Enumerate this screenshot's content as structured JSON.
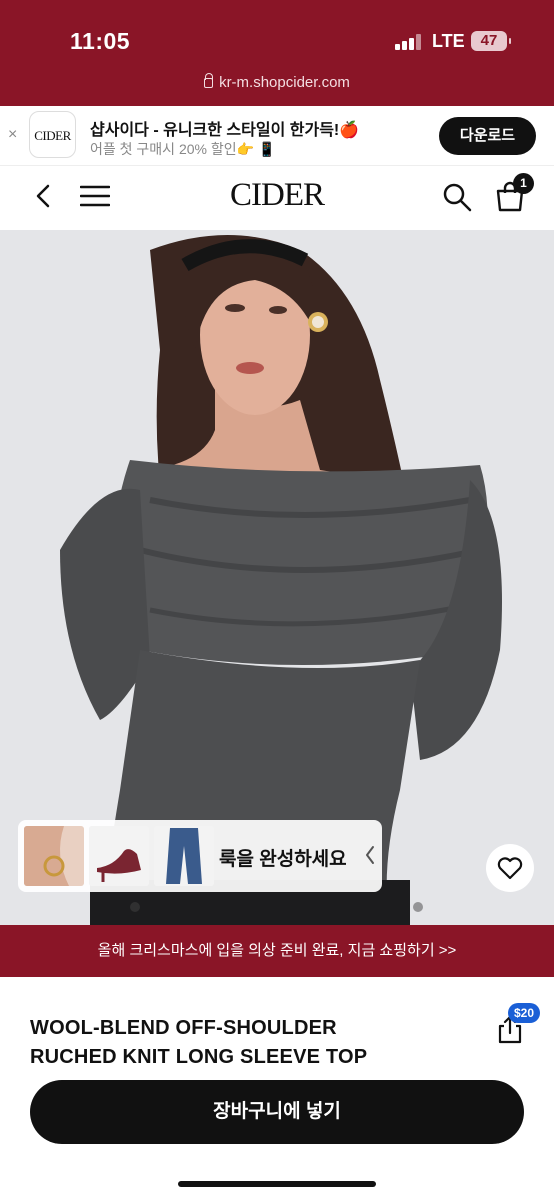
{
  "status_bar": {
    "time": "11:05",
    "network": "LTE",
    "battery": "47",
    "url": "kr-m.shopcider.com"
  },
  "app_banner": {
    "close_label": "×",
    "app_icon_label": "CIDER",
    "title": "샵사이다 - 유니크한 스타일이 한가득!🍎",
    "subtitle": "어플 첫 구매시 20% 할인👉 📱",
    "download_label": "다운로드"
  },
  "nav": {
    "logo": "CIDER",
    "cart_count": "1"
  },
  "look_card": {
    "label": "룩을 완성하세요",
    "thumbnails": [
      "earrings",
      "heels",
      "jeans"
    ]
  },
  "promo": {
    "text": "올해 크리스마스에 입을 의상 준비 완료, 지금 쇼핑하기 >>"
  },
  "product": {
    "title_line1": "WOOL-BLEND OFF-SHOULDER",
    "title_line2": "RUCHED KNIT LONG SLEEVE TOP",
    "share_badge": "$20",
    "add_to_cart_label": "장바구니에 넣기"
  },
  "colors": {
    "brand": "#8a1527",
    "button": "#111111",
    "badge": "#1a5fd6"
  },
  "icons": [
    "lock-icon",
    "back-icon",
    "menu-icon",
    "search-icon",
    "bag-icon",
    "heart-icon",
    "share-icon",
    "chevron-left-icon"
  ]
}
